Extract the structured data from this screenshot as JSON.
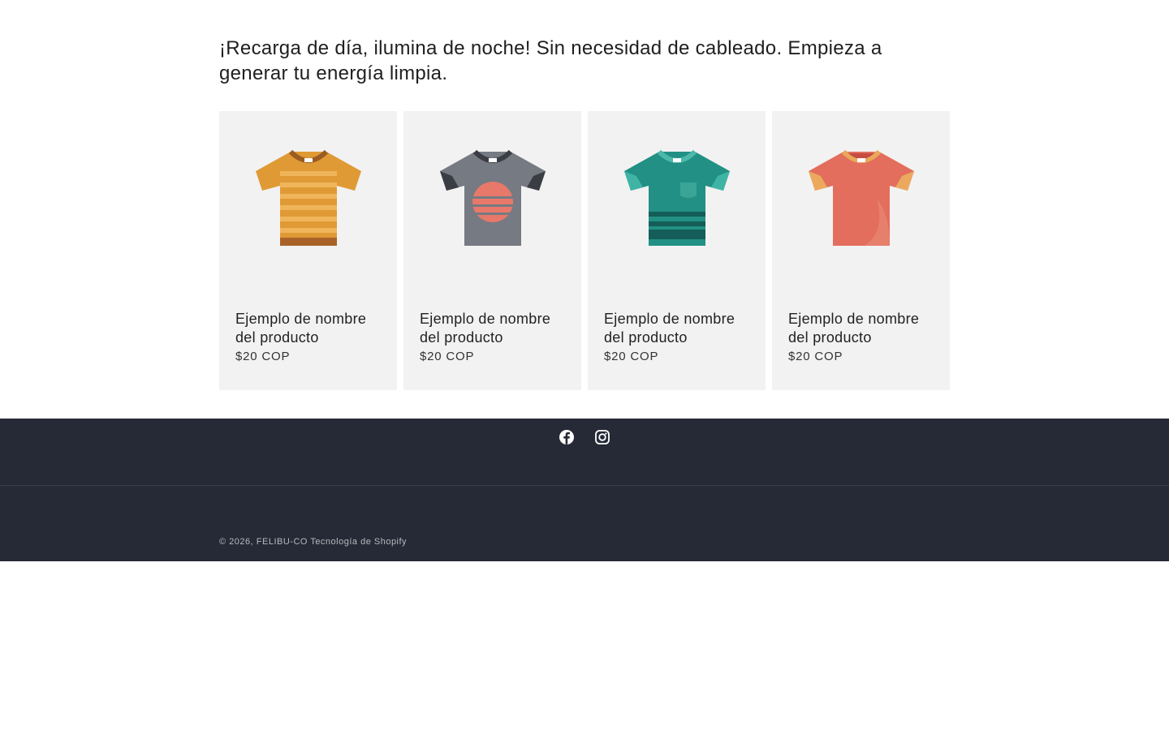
{
  "collection": {
    "heading": "¡Recarga de día, ilumina de noche! Sin necesidad de cableado. Empieza a generar tu energía limpia.",
    "products": [
      {
        "title": "Ejemplo de nombre del producto",
        "price": "$20 COP",
        "icon": "striped-tshirt-icon"
      },
      {
        "title": "Ejemplo de nombre del producto",
        "price": "$20 COP",
        "icon": "sunset-tshirt-icon"
      },
      {
        "title": "Ejemplo de nombre del producto",
        "price": "$20 COP",
        "icon": "pocket-tshirt-icon"
      },
      {
        "title": "Ejemplo de nombre del producto",
        "price": "$20 COP",
        "icon": "plain-tshirt-icon"
      }
    ]
  },
  "footer": {
    "social": [
      {
        "name": "Facebook",
        "icon": "facebook-icon"
      },
      {
        "name": "Instagram",
        "icon": "instagram-icon"
      }
    ],
    "copyright_prefix": "© 2026,",
    "store_name": "FELIBU-CO",
    "powered_by": "Tecnología de Shopify"
  },
  "colors": {
    "card_bg": "#f2f2f2",
    "footer_bg": "#262936",
    "tshirt_orange": "#e09a35",
    "tshirt_gray": "#767a82",
    "tshirt_teal": "#229084",
    "tshirt_coral": "#e36e5d"
  }
}
